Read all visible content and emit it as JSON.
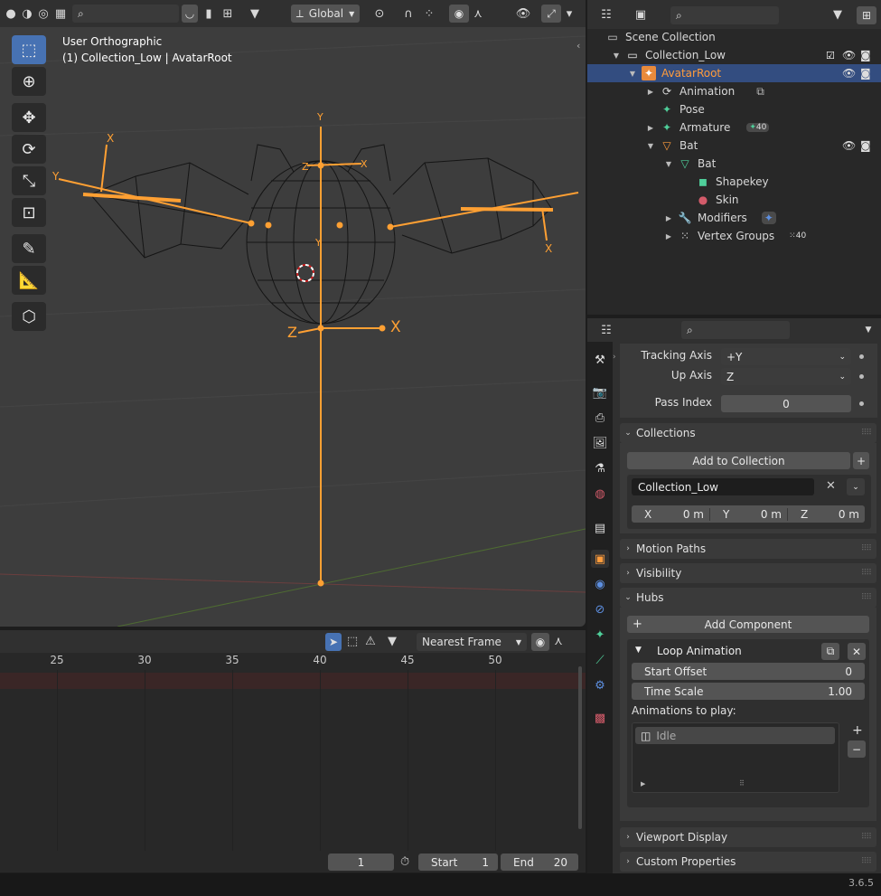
{
  "viewport": {
    "overlay_line1": "User Orthographic",
    "overlay_line2": "(1) Collection_Low | AvatarRoot",
    "orientation": "Global",
    "axis_labels": {
      "x": "X",
      "y": "Y",
      "z": "Z"
    }
  },
  "timeline": {
    "snapping": "Nearest Frame",
    "ticks": [
      "25",
      "30",
      "35",
      "40",
      "45",
      "50"
    ],
    "current_frame": "1",
    "start_label": "Start",
    "start_value": "1",
    "end_label": "End",
    "end_value": "20"
  },
  "outliner": {
    "rows": [
      {
        "label": "Scene Collection"
      },
      {
        "label": "Collection_Low"
      },
      {
        "label": "AvatarRoot"
      },
      {
        "label": "Animation"
      },
      {
        "label": "Pose"
      },
      {
        "label": "Armature",
        "badge": "40"
      },
      {
        "label": "Bat"
      },
      {
        "label": "Bat"
      },
      {
        "label": "Shapekey"
      },
      {
        "label": "Skin"
      },
      {
        "label": "Modifiers"
      },
      {
        "label": "Vertex Groups",
        "badge": "40"
      }
    ]
  },
  "properties": {
    "tracking_axis_label": "Tracking Axis",
    "tracking_axis_value": "+Y",
    "up_axis_label": "Up Axis",
    "up_axis_value": "Z",
    "pass_index_label": "Pass Index",
    "pass_index_value": "0",
    "collections_title": "Collections",
    "add_to_collection": "Add to Collection",
    "collection_name": "Collection_Low",
    "offset": {
      "x_label": "X",
      "x": "0 m",
      "y_label": "Y",
      "y": "0 m",
      "z_label": "Z",
      "z": "0 m"
    },
    "motion_paths": "Motion Paths",
    "visibility": "Visibility",
    "hubs": "Hubs",
    "add_component": "Add Component",
    "loop_animation": "Loop Animation",
    "start_offset_label": "Start Offset",
    "start_offset_value": "0",
    "time_scale_label": "Time Scale",
    "time_scale_value": "1.00",
    "animations_label": "Animations to play:",
    "animation_item": "Idle",
    "viewport_display": "Viewport Display",
    "custom_properties": "Custom Properties"
  },
  "status": {
    "version": "3.6.5"
  },
  "colors": {
    "accent": "#4772b3",
    "selection": "#334d80",
    "bone": "#ffa033",
    "armature_hl": "#ff8c00"
  }
}
